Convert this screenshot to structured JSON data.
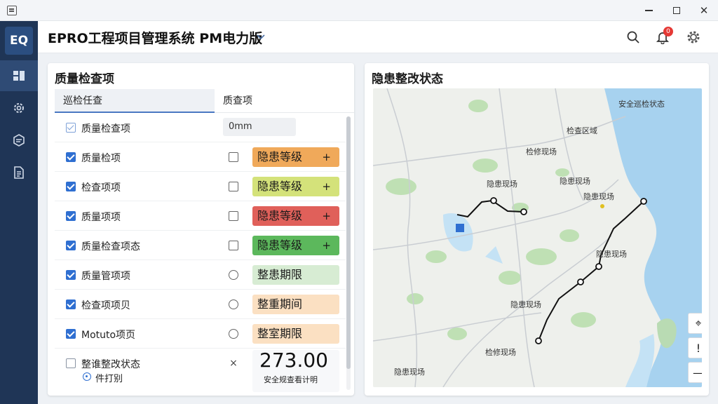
{
  "app": {
    "title": "EPRO工程项目管理系统 PM电力版",
    "logo_text": "EQ",
    "notification_count": "0"
  },
  "rail": {
    "items": [
      "dashboard-icon",
      "settings-gear-icon",
      "cube-icon",
      "document-icon"
    ]
  },
  "quality_panel": {
    "title": "质量检查项",
    "tabs": [
      "巡检任查",
      "质查项"
    ],
    "rows": [
      {
        "label": "质量检查项",
        "check": "partial",
        "field": "0mm"
      },
      {
        "label": "质量检项",
        "check": "checked",
        "control": "square",
        "pill": "隐患等级",
        "pill_color": "#f0a95a"
      },
      {
        "label": "检查项项",
        "check": "checked",
        "control": "square",
        "pill": "隐患等级",
        "pill_color": "#d4e27a"
      },
      {
        "label": "质量项项",
        "check": "checked",
        "control": "square",
        "pill": "隐患等级",
        "pill_color": "#e0605a"
      },
      {
        "label": "质量检查项态",
        "check": "checked",
        "control": "square",
        "pill": "隐患等级",
        "pill_color": "#5cb85c"
      },
      {
        "label": "质量管项项",
        "check": "checked",
        "control": "circle",
        "pill": "整患期限",
        "pill_color": "#d7ecd3"
      },
      {
        "label": "检查项项贝",
        "check": "checked",
        "control": "circle",
        "pill": "整重期间",
        "pill_color": "#fbe0c2"
      },
      {
        "label": "Motuto项页",
        "check": "checked",
        "control": "circle",
        "pill": "整室期限",
        "pill_color": "#fbe0c2"
      },
      {
        "label": "整谁整改状态",
        "check": "unchecked",
        "control": "cross",
        "sub_label": "件打别",
        "stat_value": "273.00",
        "stat_caption": "安全规查看计明"
      }
    ],
    "plus_sign": "+"
  },
  "map_panel": {
    "title": "隐患整改状态",
    "labels": [
      "安全巡检状态",
      "检查区域",
      "检修现场",
      "隐患现场",
      "隐患现场",
      "隐患现场",
      "隐患现场",
      "隐患现场",
      "检修现场",
      "隐患现场"
    ],
    "controls": [
      "locate-icon",
      "alert-icon",
      "zoom-out-icon"
    ],
    "control_glyphs": [
      "⌖",
      "!",
      "—"
    ]
  },
  "colors": {
    "rail": "#1f3556",
    "accent": "#2f6fd1",
    "sea": "#a7d2ef",
    "land": "#eef0ec",
    "route": "#111111"
  }
}
